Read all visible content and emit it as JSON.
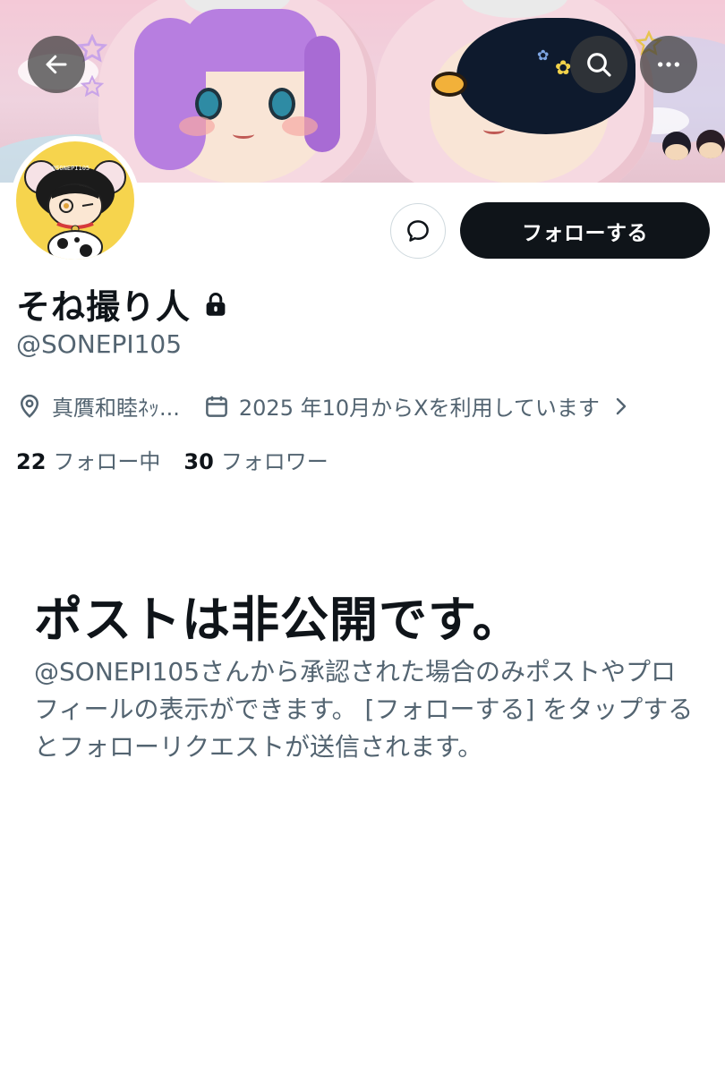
{
  "header": {
    "back_icon": "arrow-left-icon",
    "search_icon": "search-icon",
    "more_icon": "more-horizontal-icon",
    "banner_description": "pink-plush-banner"
  },
  "profile": {
    "avatar_icon": "avatar",
    "avatar_watermark": "@SONEPI105",
    "display_name": "そね撮り人",
    "protected_icon": "lock-icon",
    "handle": "@SONEPI105",
    "location": "真贋和睦ﾈｯ...",
    "joined": "2025 年10月からXを利用しています",
    "following_count": "22",
    "following_label": "フォロー中",
    "followers_count": "30",
    "followers_label": "フォロワー"
  },
  "actions": {
    "dm_icon": "message-bubble-icon",
    "follow_label": "フォローする"
  },
  "protected_notice": {
    "title": "ポストは非公開です。",
    "body": "@SONEPI105さんから承認された場合のみポストやプロフィールの表示ができます。 [フォローする] をタップするとフォローリクエストが送信されます。"
  },
  "colors": {
    "text_primary": "#0f1419",
    "text_secondary": "#536471",
    "button_bg": "#0f1419",
    "banner_pink": "#f4c9d7",
    "avatar_yellow": "#f6d44d"
  }
}
